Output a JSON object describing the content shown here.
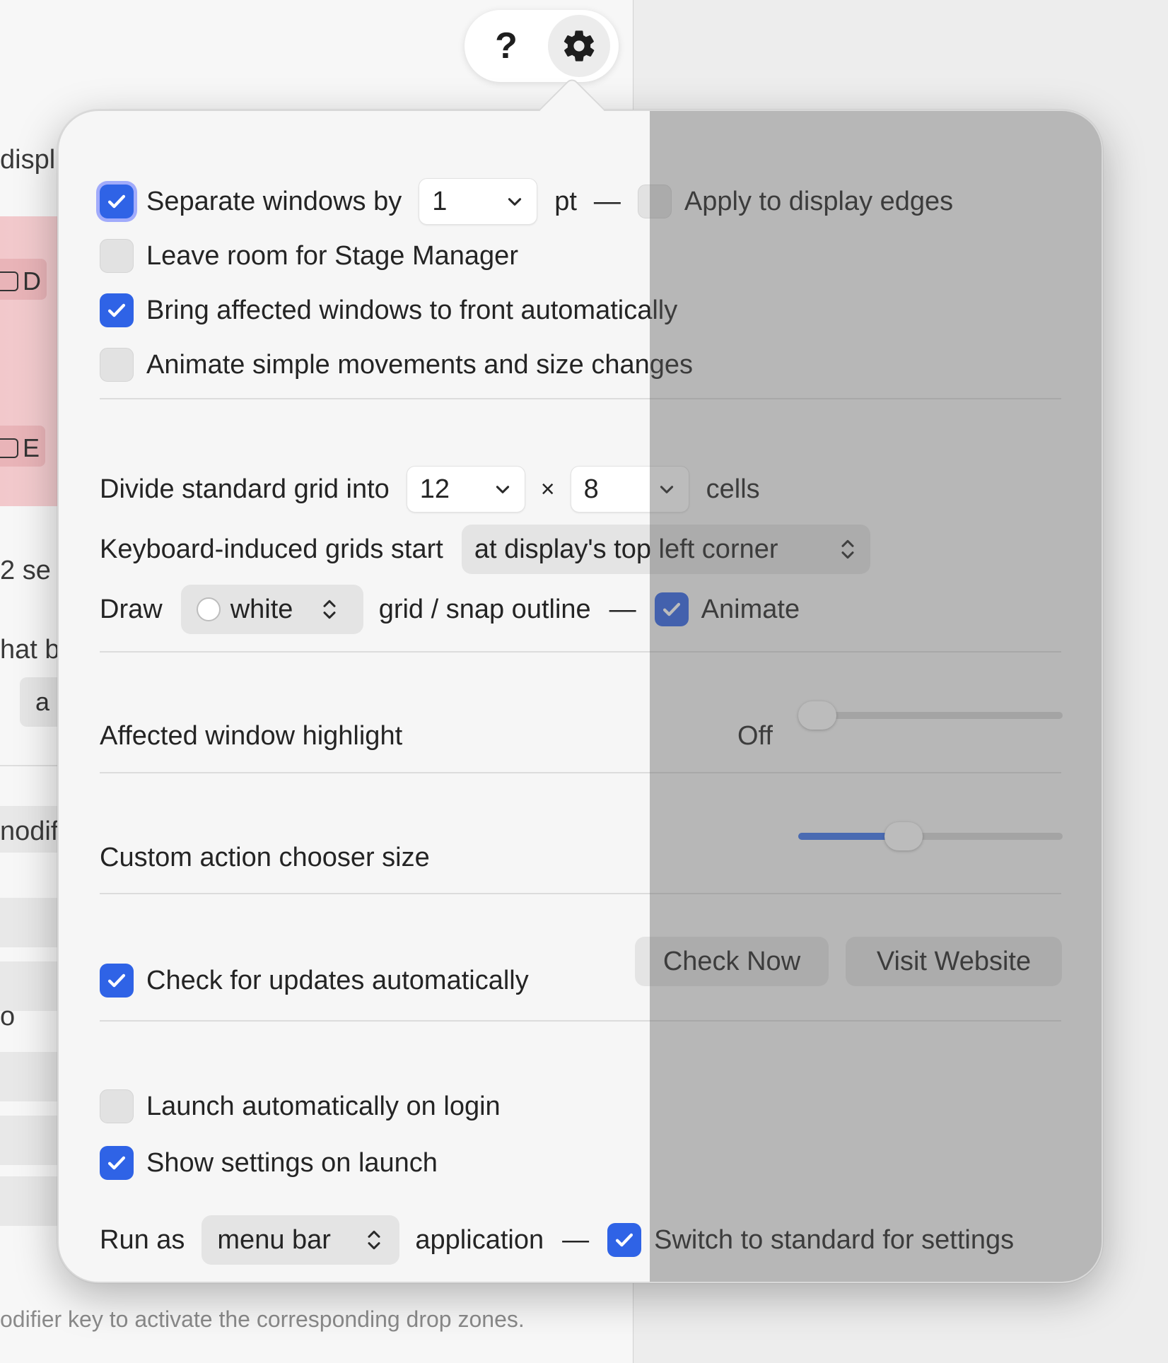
{
  "background": {
    "frag_displ": "displ",
    "key_d": "D",
    "key_e": "E",
    "frag_2se": "2 se",
    "frag_hatb": "hat b",
    "chip_a": "a",
    "frag_modif": "nodif",
    "frag_o": "o",
    "footer": "odifier key to activate the corresponding drop zones."
  },
  "toolbar": {
    "help_label": "?",
    "settings_icon": "gear-icon"
  },
  "settings": {
    "separate": {
      "label": "Separate windows by",
      "checked": true,
      "value": "1",
      "unit": "pt",
      "dash": "—"
    },
    "display_edges": {
      "label": "Apply to display edges",
      "checked": false
    },
    "stage_manager": {
      "label": "Leave room for Stage Manager",
      "checked": false
    },
    "bring_front": {
      "label": "Bring affected windows to front automatically",
      "checked": true
    },
    "animate_simple": {
      "label": "Animate simple movements and size changes",
      "checked": false
    },
    "grid": {
      "label": "Divide standard grid into",
      "cols": "12",
      "times": "×",
      "rows": "8",
      "suffix": "cells"
    },
    "keyboard_grids": {
      "label": "Keyboard-induced grids start",
      "value": "at display's top left corner"
    },
    "draw": {
      "label": "Draw",
      "color_value": "white",
      "suffix": "grid / snap outline",
      "dash": "—",
      "animate_label": "Animate",
      "animate_checked": true
    },
    "highlight": {
      "label": "Affected window highlight",
      "value_label": "Off",
      "level": 0
    },
    "chooser_size": {
      "label": "Custom action chooser size",
      "level": 0.38
    },
    "updates": {
      "label": "Check for updates automatically",
      "checked": true,
      "check_now": "Check Now",
      "visit_website": "Visit Website"
    },
    "launch_login": {
      "label": "Launch automatically on login",
      "checked": false
    },
    "show_settings": {
      "label": "Show settings on launch",
      "checked": true
    },
    "run_as": {
      "label": "Run as",
      "value": "menu bar",
      "suffix": "application",
      "dash": "—",
      "switch_label": "Switch to standard for settings",
      "switch_checked": true
    }
  },
  "colors": {
    "accent": "#2f63e6",
    "slider_fill": "#3b74ee"
  }
}
